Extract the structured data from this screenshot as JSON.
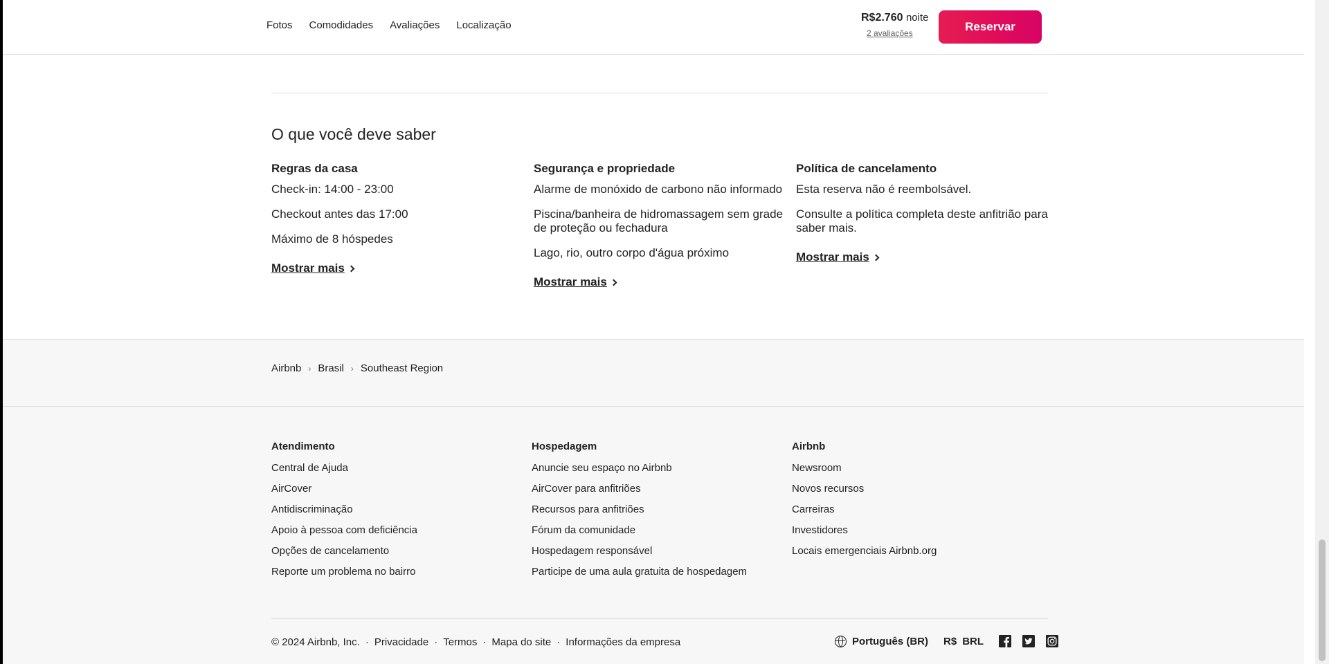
{
  "header": {
    "nav": [
      "Fotos",
      "Comodidades",
      "Avaliações",
      "Localização"
    ],
    "price": "R$2.760",
    "price_unit": "noite",
    "reviews": "2 avaliações",
    "reserve_label": "Reservar"
  },
  "know": {
    "title": "O que você deve saber",
    "columns": [
      {
        "title": "Regras da casa",
        "items": [
          "Check-in: 14:00 - 23:00",
          "Checkout antes das 17:00",
          "Máximo de 8 hóspedes"
        ],
        "more": "Mostrar mais"
      },
      {
        "title": "Segurança e propriedade",
        "items": [
          "Alarme de monóxido de carbono não informado",
          "Piscina/banheira de hidromassagem sem grade de proteção ou fechadura",
          "Lago, rio, outro corpo d'água próximo"
        ],
        "more": "Mostrar mais"
      },
      {
        "title": "Política de cancelamento",
        "items": [
          "Esta reserva não é reembolsável.",
          "Consulte a política completa deste anfitrião para saber mais."
        ],
        "more": "Mostrar mais"
      }
    ]
  },
  "breadcrumb": [
    "Airbnb",
    "Brasil",
    "Southeast Region"
  ],
  "footer": {
    "columns": [
      {
        "title": "Atendimento",
        "links": [
          "Central de Ajuda",
          "AirCover",
          "Antidiscriminação",
          "Apoio à pessoa com deficiência",
          "Opções de cancelamento",
          "Reporte um problema no bairro"
        ]
      },
      {
        "title": "Hospedagem",
        "links": [
          "Anuncie seu espaço no Airbnb",
          "AirCover para anfitriões",
          "Recursos para anfitriões",
          "Fórum da comunidade",
          "Hospedagem responsável",
          "Participe de uma aula gratuita de hospedagem"
        ]
      },
      {
        "title": "Airbnb",
        "links": [
          "Newsroom",
          "Novos recursos",
          "Carreiras",
          "Investidores",
          "Locais emergenciais Airbnb.org"
        ]
      }
    ],
    "legal": [
      "© 2024 Airbnb, Inc.",
      "Privacidade",
      "Termos",
      "Mapa do site",
      "Informações da empresa"
    ],
    "separator": "·",
    "language": "Português (BR)",
    "currency_symbol": "R$",
    "currency_code": "BRL",
    "social_icons": [
      "facebook-icon",
      "twitter-icon",
      "instagram-icon"
    ]
  },
  "colors": {
    "accent": "#e51d53",
    "text": "#222222",
    "footer_bg": "#f7f7f7"
  }
}
